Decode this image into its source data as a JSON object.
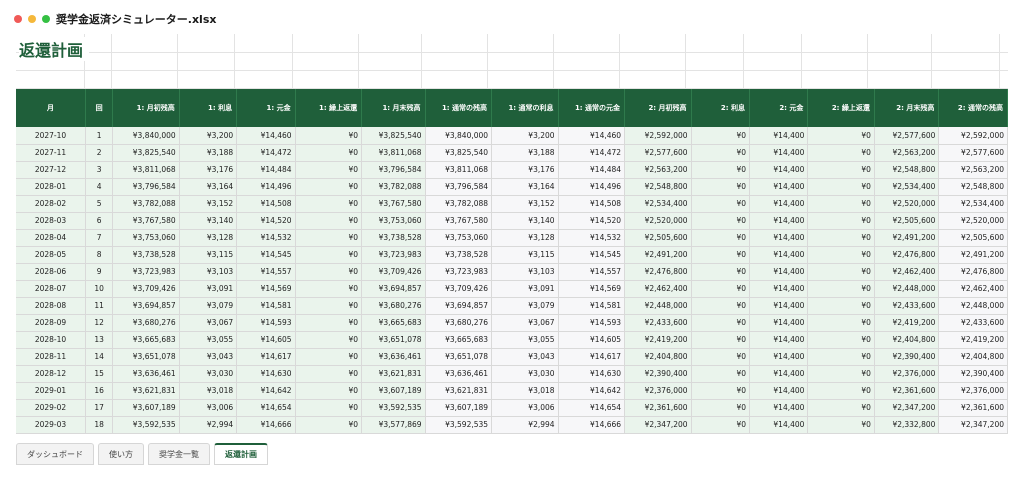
{
  "window": {
    "title": "奨学金返済シミュレーター.xlsx"
  },
  "sheet": {
    "title": "返還計画",
    "headers": [
      "月",
      "回",
      "1: 月初残高",
      "1: 利息",
      "1: 元金",
      "1: 繰上返還",
      "1: 月末残高",
      "1: 通常の残高",
      "1: 通常の利息",
      "1: 通常の元金",
      "2: 月初残高",
      "2: 利息",
      "2: 元金",
      "2: 繰上返還",
      "2: 月末残高",
      "2: 通常の残高"
    ],
    "rows": [
      [
        "2027-10",
        "1",
        "¥3,840,000",
        "¥3,200",
        "¥14,460",
        "¥0",
        "¥3,825,540",
        "¥3,840,000",
        "¥3,200",
        "¥14,460",
        "¥2,592,000",
        "¥0",
        "¥14,400",
        "¥0",
        "¥2,577,600",
        "¥2,592,000"
      ],
      [
        "2027-11",
        "2",
        "¥3,825,540",
        "¥3,188",
        "¥14,472",
        "¥0",
        "¥3,811,068",
        "¥3,825,540",
        "¥3,188",
        "¥14,472",
        "¥2,577,600",
        "¥0",
        "¥14,400",
        "¥0",
        "¥2,563,200",
        "¥2,577,600"
      ],
      [
        "2027-12",
        "3",
        "¥3,811,068",
        "¥3,176",
        "¥14,484",
        "¥0",
        "¥3,796,584",
        "¥3,811,068",
        "¥3,176",
        "¥14,484",
        "¥2,563,200",
        "¥0",
        "¥14,400",
        "¥0",
        "¥2,548,800",
        "¥2,563,200"
      ],
      [
        "2028-01",
        "4",
        "¥3,796,584",
        "¥3,164",
        "¥14,496",
        "¥0",
        "¥3,782,088",
        "¥3,796,584",
        "¥3,164",
        "¥14,496",
        "¥2,548,800",
        "¥0",
        "¥14,400",
        "¥0",
        "¥2,534,400",
        "¥2,548,800"
      ],
      [
        "2028-02",
        "5",
        "¥3,782,088",
        "¥3,152",
        "¥14,508",
        "¥0",
        "¥3,767,580",
        "¥3,782,088",
        "¥3,152",
        "¥14,508",
        "¥2,534,400",
        "¥0",
        "¥14,400",
        "¥0",
        "¥2,520,000",
        "¥2,534,400"
      ],
      [
        "2028-03",
        "6",
        "¥3,767,580",
        "¥3,140",
        "¥14,520",
        "¥0",
        "¥3,753,060",
        "¥3,767,580",
        "¥3,140",
        "¥14,520",
        "¥2,520,000",
        "¥0",
        "¥14,400",
        "¥0",
        "¥2,505,600",
        "¥2,520,000"
      ],
      [
        "2028-04",
        "7",
        "¥3,753,060",
        "¥3,128",
        "¥14,532",
        "¥0",
        "¥3,738,528",
        "¥3,753,060",
        "¥3,128",
        "¥14,532",
        "¥2,505,600",
        "¥0",
        "¥14,400",
        "¥0",
        "¥2,491,200",
        "¥2,505,600"
      ],
      [
        "2028-05",
        "8",
        "¥3,738,528",
        "¥3,115",
        "¥14,545",
        "¥0",
        "¥3,723,983",
        "¥3,738,528",
        "¥3,115",
        "¥14,545",
        "¥2,491,200",
        "¥0",
        "¥14,400",
        "¥0",
        "¥2,476,800",
        "¥2,491,200"
      ],
      [
        "2028-06",
        "9",
        "¥3,723,983",
        "¥3,103",
        "¥14,557",
        "¥0",
        "¥3,709,426",
        "¥3,723,983",
        "¥3,103",
        "¥14,557",
        "¥2,476,800",
        "¥0",
        "¥14,400",
        "¥0",
        "¥2,462,400",
        "¥2,476,800"
      ],
      [
        "2028-07",
        "10",
        "¥3,709,426",
        "¥3,091",
        "¥14,569",
        "¥0",
        "¥3,694,857",
        "¥3,709,426",
        "¥3,091",
        "¥14,569",
        "¥2,462,400",
        "¥0",
        "¥14,400",
        "¥0",
        "¥2,448,000",
        "¥2,462,400"
      ],
      [
        "2028-08",
        "11",
        "¥3,694,857",
        "¥3,079",
        "¥14,581",
        "¥0",
        "¥3,680,276",
        "¥3,694,857",
        "¥3,079",
        "¥14,581",
        "¥2,448,000",
        "¥0",
        "¥14,400",
        "¥0",
        "¥2,433,600",
        "¥2,448,000"
      ],
      [
        "2028-09",
        "12",
        "¥3,680,276",
        "¥3,067",
        "¥14,593",
        "¥0",
        "¥3,665,683",
        "¥3,680,276",
        "¥3,067",
        "¥14,593",
        "¥2,433,600",
        "¥0",
        "¥14,400",
        "¥0",
        "¥2,419,200",
        "¥2,433,600"
      ],
      [
        "2028-10",
        "13",
        "¥3,665,683",
        "¥3,055",
        "¥14,605",
        "¥0",
        "¥3,651,078",
        "¥3,665,683",
        "¥3,055",
        "¥14,605",
        "¥2,419,200",
        "¥0",
        "¥14,400",
        "¥0",
        "¥2,404,800",
        "¥2,419,200"
      ],
      [
        "2028-11",
        "14",
        "¥3,651,078",
        "¥3,043",
        "¥14,617",
        "¥0",
        "¥3,636,461",
        "¥3,651,078",
        "¥3,043",
        "¥14,617",
        "¥2,404,800",
        "¥0",
        "¥14,400",
        "¥0",
        "¥2,390,400",
        "¥2,404,800"
      ],
      [
        "2028-12",
        "15",
        "¥3,636,461",
        "¥3,030",
        "¥14,630",
        "¥0",
        "¥3,621,831",
        "¥3,636,461",
        "¥3,030",
        "¥14,630",
        "¥2,390,400",
        "¥0",
        "¥14,400",
        "¥0",
        "¥2,376,000",
        "¥2,390,400"
      ],
      [
        "2029-01",
        "16",
        "¥3,621,831",
        "¥3,018",
        "¥14,642",
        "¥0",
        "¥3,607,189",
        "¥3,621,831",
        "¥3,018",
        "¥14,642",
        "¥2,376,000",
        "¥0",
        "¥14,400",
        "¥0",
        "¥2,361,600",
        "¥2,376,000"
      ],
      [
        "2029-02",
        "17",
        "¥3,607,189",
        "¥3,006",
        "¥14,654",
        "¥0",
        "¥3,592,535",
        "¥3,607,189",
        "¥3,006",
        "¥14,654",
        "¥2,361,600",
        "¥0",
        "¥14,400",
        "¥0",
        "¥2,347,200",
        "¥2,361,600"
      ],
      [
        "2029-03",
        "18",
        "¥3,592,535",
        "¥2,994",
        "¥14,666",
        "¥0",
        "¥3,577,869",
        "¥3,592,535",
        "¥2,994",
        "¥14,666",
        "¥2,347,200",
        "¥0",
        "¥14,400",
        "¥0",
        "¥2,332,800",
        "¥2,347,200"
      ]
    ]
  },
  "tabs": [
    {
      "label": "ダッシュボード",
      "active": false
    },
    {
      "label": "使い方",
      "active": false
    },
    {
      "label": "奨学金一覧",
      "active": false
    },
    {
      "label": "返還計画",
      "active": true
    }
  ],
  "colors": {
    "accent": "#1f5f3a",
    "row_tint": "#eaf4ec"
  }
}
